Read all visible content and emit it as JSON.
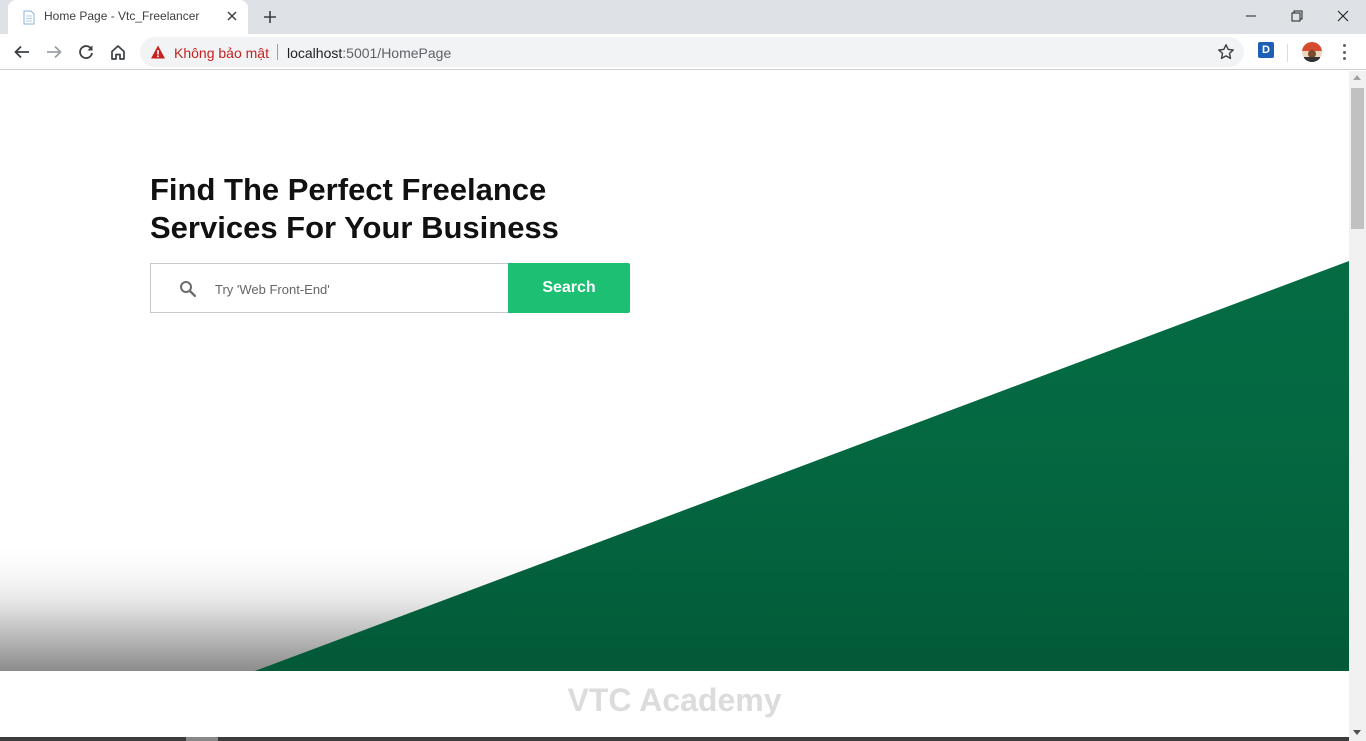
{
  "browser": {
    "tab_title": "Home Page - Vtc_Freelancer",
    "security_label": "Không bảo mật",
    "url_host": "localhost",
    "url_path": ":5001/HomePage",
    "extension_label": "D"
  },
  "hero": {
    "heading": "Find The Perfect Freelance Services For Your Business",
    "search_placeholder": "Try 'Web Front-End'",
    "search_button": "Search"
  },
  "footer": {
    "title": "VTC Academy"
  },
  "colors": {
    "accent": "#1dbf73",
    "hero_green": "#046b43",
    "warning": "#c5221f"
  }
}
